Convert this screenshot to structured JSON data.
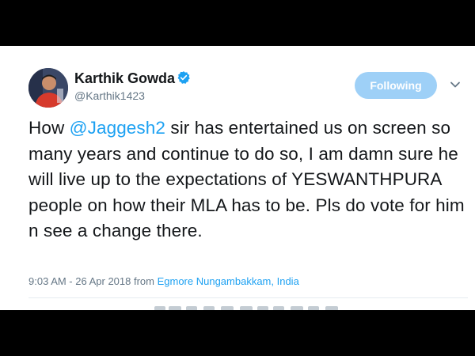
{
  "author": {
    "name": "Karthik Gowda",
    "handle": "@Karthik1423",
    "verified_icon": "verified-badge-icon"
  },
  "follow_button": {
    "label": "Following"
  },
  "menu": {
    "icon": "chevron-down-icon"
  },
  "tweet": {
    "text_before_mention": "How ",
    "mention": "@Jaggesh2",
    "text_after_mention": " sir has entertained us on screen so many years and continue to do so, I am damn sure he will live up to the expectations of YESWANTHPURA people on how their MLA has to be. Pls do vote for him n see a change there."
  },
  "meta": {
    "timestamp": "9:03 AM - 26 Apr 2018 from ",
    "location": "Egmore Nungambakkam, India"
  },
  "colors": {
    "link": "#1da1f2",
    "follow_button_bg": "#9ed0f7",
    "secondary_text": "#657786",
    "primary_text": "#14171a",
    "background_frame": "#000000"
  }
}
